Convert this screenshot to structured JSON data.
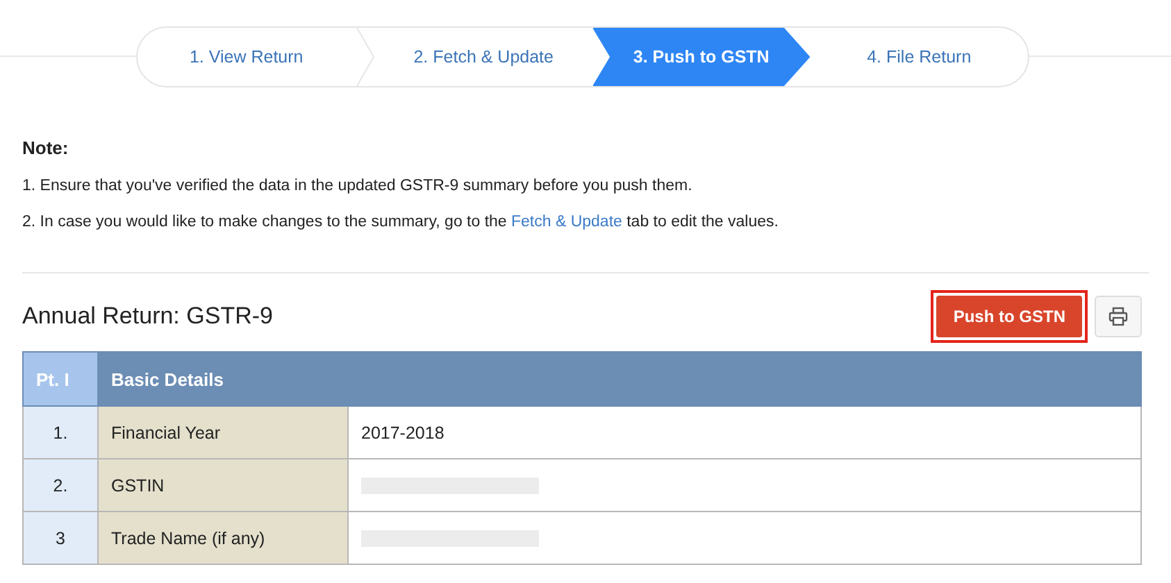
{
  "steps": [
    {
      "label": "1. View Return",
      "selected": false
    },
    {
      "label": "2. Fetch & Update",
      "selected": false
    },
    {
      "label": "3. Push to GSTN",
      "selected": true
    },
    {
      "label": "4. File Return",
      "selected": false
    }
  ],
  "note": {
    "title": "Note:",
    "items": [
      {
        "text": "1. Ensure that you've verified the data in the updated GSTR-9 summary before you push them."
      },
      {
        "text": "2. In case you would like to make changes to the summary, go to the ",
        "link": "Fetch & Update",
        "after": " tab to edit the values."
      }
    ]
  },
  "return": {
    "title": "Annual Return: GSTR-9",
    "push_button": {
      "label": "Push to GSTN",
      "focused": true
    }
  },
  "table": {
    "header": {
      "part": "Pt. I",
      "title": "Basic Details"
    },
    "rows": [
      {
        "no": "1.",
        "label": "Financial Year",
        "value": "2017-2018",
        "redacted": false
      },
      {
        "no": "2.",
        "label": "GSTIN",
        "redacted": true
      },
      {
        "no": "3",
        "label": "Trade Name (if any)",
        "redacted": true
      }
    ]
  }
}
